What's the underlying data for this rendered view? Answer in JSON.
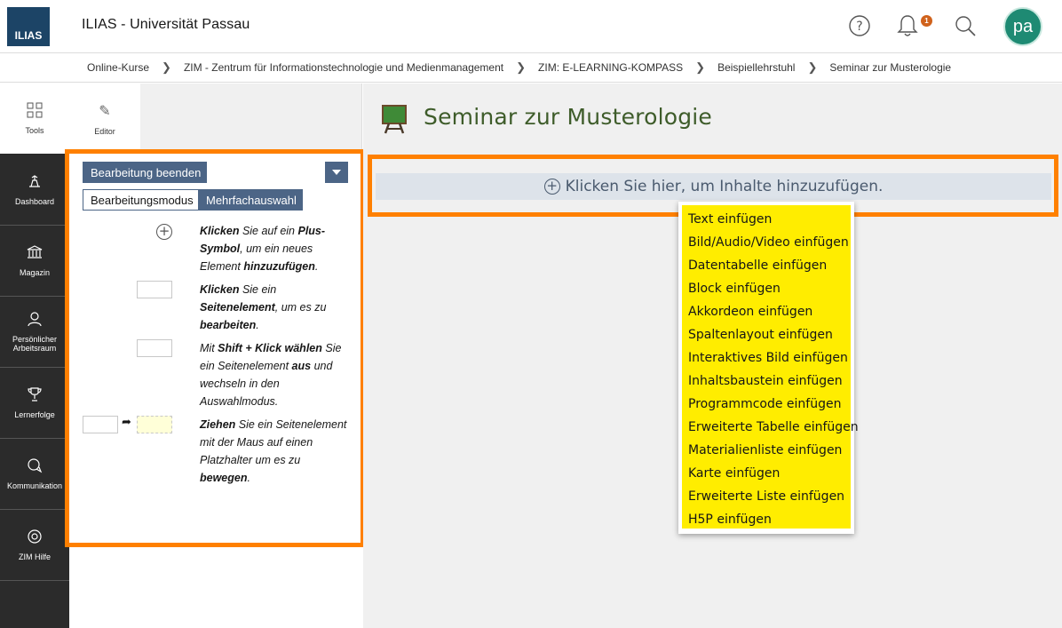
{
  "header": {
    "logo_text": "ILIAS",
    "title": "ILIAS - Universität Passau",
    "notification_count": "1",
    "avatar_initials": "pa"
  },
  "breadcrumb": [
    "Online-Kurse",
    "ZIM - Zentrum für Informationstechnologie und Medienmanagement",
    "ZIM: E-LEARNING-KOMPASS",
    "Beispiellehrstuhl",
    "Seminar zur Musterologie"
  ],
  "mainbar": {
    "tools": "Tools",
    "items": [
      "Dashboard",
      "Magazin",
      "Persönlicher Arbeitsraum",
      "Lernerfolge",
      "Kommunikation",
      "ZIM Hilfe"
    ]
  },
  "editor": {
    "tab_label": "Editor",
    "end_button": "Bearbeitung beenden",
    "mode_edit": "Bearbeitungsmodus",
    "mode_multi": "Mehrfachauswahl",
    "help": [
      {
        "b1": "Klicken",
        "t1": " Sie auf ein ",
        "b2": "Plus-Symbol",
        "t2": ", um ein neues Element ",
        "b3": "hinzuzufügen",
        "t3": "."
      },
      {
        "b1": "Klicken",
        "t1": " Sie ein ",
        "b2": "Seitenelement",
        "t2": ", um es zu ",
        "b3": "bearbeiten",
        "t3": "."
      },
      {
        "b1": "",
        "t1": "Mit ",
        "b2": "Shift + Klick wählen",
        "t2": " Sie ein Seitenelement ",
        "b3": "aus",
        "t3": " und wechseln in den Auswahlmodus."
      },
      {
        "b1": "Ziehen",
        "t1": " Sie ein Seitenelement mit der Maus auf einen Platzhalter um es zu ",
        "b2": "bewegen",
        "t2": ".",
        "b3": "",
        "t3": ""
      }
    ]
  },
  "content": {
    "title": "Seminar zur Musterologie",
    "add_prompt": "Klicken Sie hier, um Inhalte hinzuzufügen.",
    "menu": [
      "Text einfügen",
      "Bild/Audio/Video einfügen",
      "Datentabelle einfügen",
      "Block einfügen",
      "Akkordeon einfügen",
      "Spaltenlayout einfügen",
      "Interaktives Bild einfügen",
      "Inhaltsbaustein einfügen",
      "Programmcode einfügen",
      "Erweiterte Tabelle einfügen",
      "Materialienliste einfügen",
      "Karte einfügen",
      "Erweiterte Liste einfügen",
      "H5P einfügen"
    ]
  },
  "colors": {
    "highlight": "#ff8000",
    "menu_bg": "#ffed00",
    "button": "#4c6586",
    "title": "#3e5c2a"
  }
}
